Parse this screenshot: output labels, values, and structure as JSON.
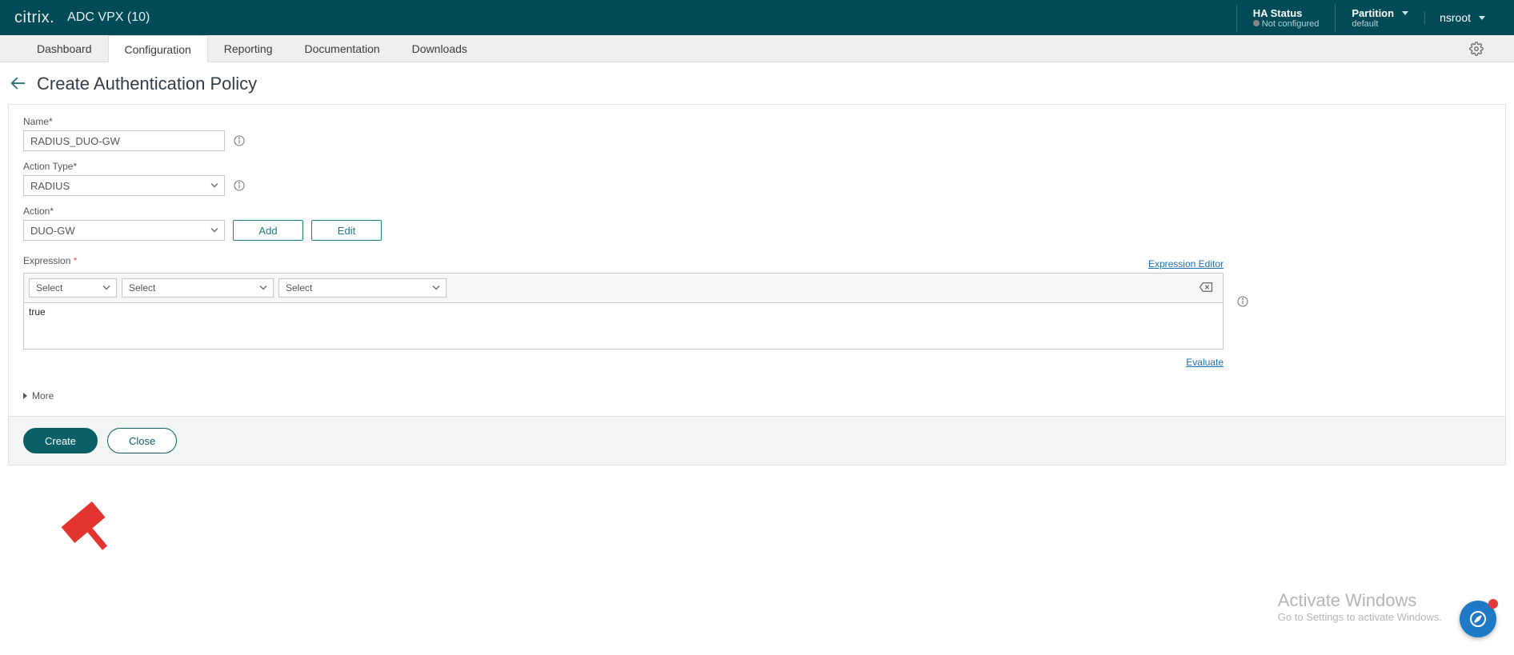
{
  "header": {
    "brand": "citrix.",
    "product": "ADC VPX (10)",
    "ha_status_title": "HA Status",
    "ha_status_value": "Not configured",
    "partition_title": "Partition",
    "partition_value": "default",
    "user": "nsroot"
  },
  "tabs": {
    "dashboard": "Dashboard",
    "configuration": "Configuration",
    "reporting": "Reporting",
    "documentation": "Documentation",
    "downloads": "Downloads"
  },
  "page": {
    "title": "Create Authentication Policy"
  },
  "form": {
    "name_label": "Name*",
    "name_value": "RADIUS_DUO-GW",
    "action_type_label": "Action Type*",
    "action_type_value": "RADIUS",
    "action_label": "Action*",
    "action_value": "DUO-GW",
    "add_btn": "Add",
    "edit_btn": "Edit",
    "expression_label": "Expression",
    "expression_editor_link": "Expression Editor",
    "expr_select1": "Select",
    "expr_select2": "Select",
    "expr_select3": "Select",
    "expression_value": "true",
    "evaluate_link": "Evaluate",
    "more_label": "More"
  },
  "footer": {
    "create_btn": "Create",
    "close_btn": "Close"
  },
  "watermark": {
    "title": "Activate Windows",
    "sub": "Go to Settings to activate Windows."
  }
}
